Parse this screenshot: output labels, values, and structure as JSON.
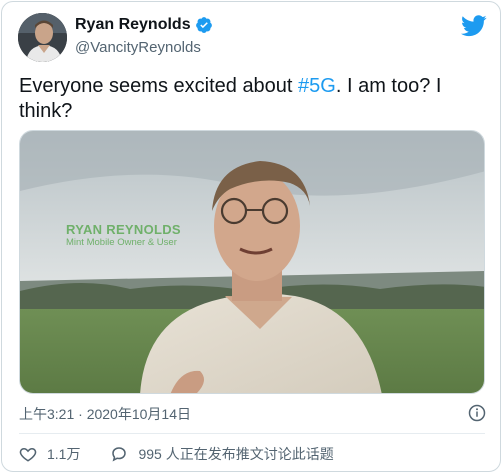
{
  "tweet": {
    "author_name": "Ryan Reynolds",
    "author_handle": "@VancityReynolds",
    "text_before": "Everyone seems excited about ",
    "hashtag": "#5G",
    "text_after": ". I am too? I think?",
    "timestamp": "上午3:21 · 2020年10月14日",
    "like_count": "1.1万",
    "reply_text": "995 人正在发布推文讨论此话题"
  },
  "media": {
    "overlay_name": "RYAN REYNOLDS",
    "overlay_title": "Mint Mobile Owner & User"
  },
  "icons": {
    "brand": "twitter-bird-icon",
    "verified": "verified-badge-icon",
    "info": "info-icon",
    "like": "heart-icon",
    "reply": "reply-bubble-icon"
  },
  "colors": {
    "accent": "#1d9bf0",
    "text_primary": "#0f1419",
    "text_secondary": "#536471",
    "overlay_green": "#6fb06a"
  }
}
